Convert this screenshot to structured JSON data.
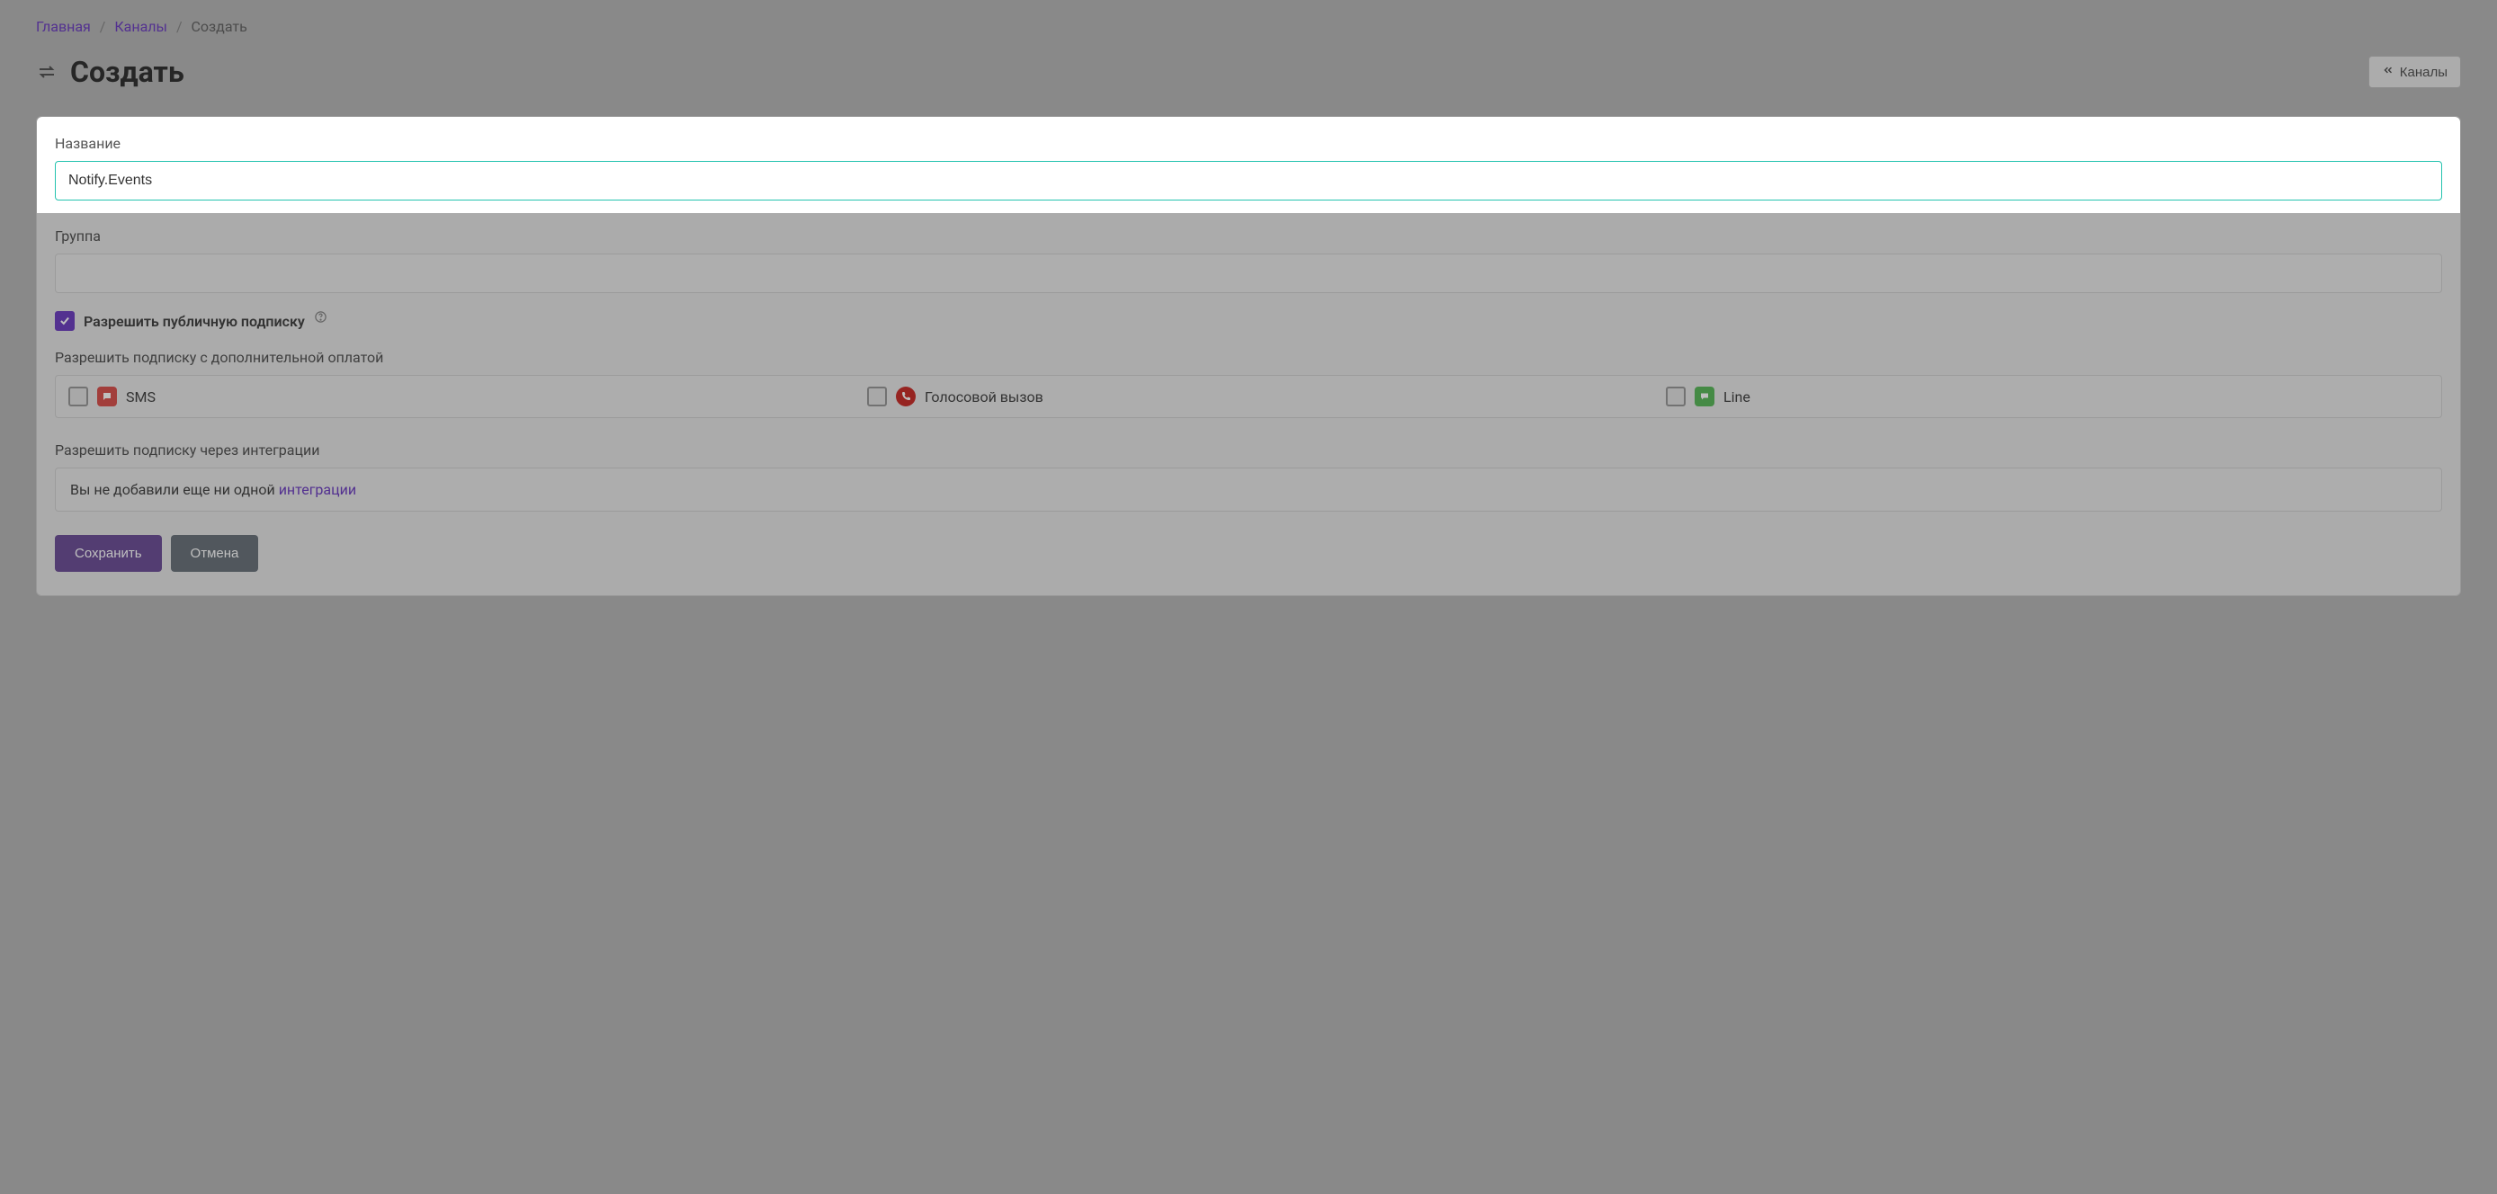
{
  "breadcrumb": {
    "home": "Главная",
    "channels": "Каналы",
    "create": "Создать"
  },
  "heading": {
    "title": "Создать",
    "back_button": "Каналы"
  },
  "form": {
    "name_label": "Название",
    "name_value": "Notify.Events",
    "group_label": "Группа",
    "group_value": "",
    "public_sub_label": "Разрешить публичную подписку",
    "public_sub_checked": true,
    "paid_sub_label": "Разрешить подписку с дополнительной оплатой",
    "paid_options": [
      {
        "key": "sms",
        "label": "SMS",
        "checked": false,
        "icon": "sms-icon"
      },
      {
        "key": "voice",
        "label": "Голосовой вызов",
        "checked": false,
        "icon": "phone-icon"
      },
      {
        "key": "line",
        "label": "Line",
        "checked": false,
        "icon": "line-icon"
      }
    ],
    "integrations_label": "Разрешить подписку через интеграции",
    "integrations_empty_prefix": "Вы не добавили еще ни одной ",
    "integrations_empty_link": "интеграции",
    "save_label": "Сохранить",
    "cancel_label": "Отмена"
  }
}
